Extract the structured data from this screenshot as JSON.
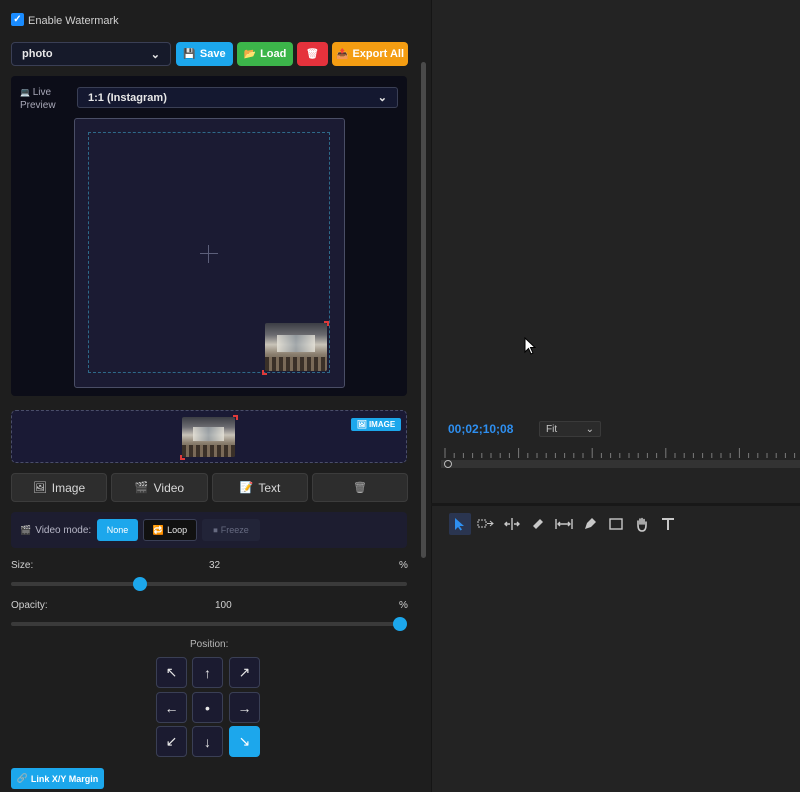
{
  "watermark": {
    "enable_label": "Enable Watermark",
    "enabled": true
  },
  "presets": {
    "selected": "photo",
    "save_label": "Save",
    "load_label": "Load",
    "export_label": "Export All"
  },
  "preview": {
    "live_label_1": "Live",
    "live_label_2": "Preview",
    "aspect_ratio": "1:1 (Instagram)"
  },
  "drop_zone": {
    "badge_label": "IMAGE"
  },
  "type_buttons": {
    "image": "Image",
    "video": "Video",
    "text": "Text"
  },
  "video_mode": {
    "label": "Video mode:",
    "options": [
      "None",
      "Loop",
      "Freeze"
    ],
    "selected": "None"
  },
  "size": {
    "label": "Size:",
    "value": "32",
    "unit": "%",
    "fraction": 0.32
  },
  "opacity": {
    "label": "Opacity:",
    "value": "100",
    "unit": "%",
    "fraction": 1.0
  },
  "position": {
    "label": "Position:",
    "arrows": [
      "↖",
      "↑",
      "↗",
      "←",
      "•",
      "→",
      "↙",
      "↓",
      "↘"
    ],
    "selected": "bottom-right"
  },
  "link_margin": {
    "label": "Link X/Y Margin"
  },
  "editor": {
    "timecode": "00;02;10;08",
    "zoom": "Fit"
  },
  "colors": {
    "accent": "#1ca7ec",
    "save": "#1ca7ec",
    "load": "#3cb54a",
    "delete": "#e5323c",
    "export": "#f49d12",
    "timecode": "#2e8ff0"
  }
}
